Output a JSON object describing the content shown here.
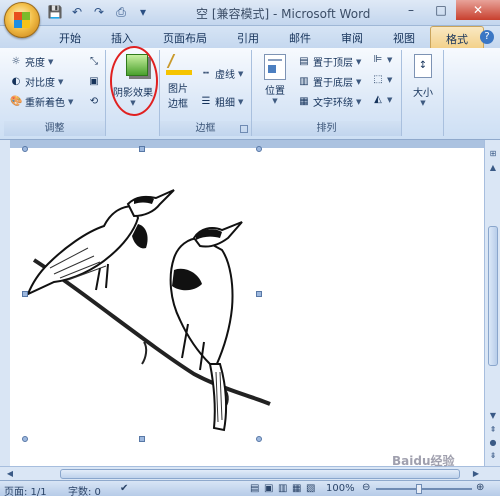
{
  "window": {
    "title": "空 [兼容模式] - Microsoft Word",
    "controls": {
      "minimize": "–",
      "maximize": "□",
      "close": "✕"
    }
  },
  "quick_access": [
    {
      "name": "save-icon",
      "glyph": "💾"
    },
    {
      "name": "undo-icon",
      "glyph": "↶"
    },
    {
      "name": "redo-icon",
      "glyph": "↷"
    },
    {
      "name": "print-icon",
      "glyph": "⎙"
    },
    {
      "name": "customize-icon",
      "glyph": "▾"
    }
  ],
  "tabs": [
    {
      "label": "开始"
    },
    {
      "label": "插入"
    },
    {
      "label": "页面布局"
    },
    {
      "label": "引用"
    },
    {
      "label": "邮件"
    },
    {
      "label": "审阅"
    },
    {
      "label": "视图"
    },
    {
      "label": "格式",
      "active": true
    }
  ],
  "ribbon": {
    "adjust": {
      "label": "调整",
      "brightness": "亮度",
      "contrast": "对比度",
      "recolor": "重新着色"
    },
    "shadow": {
      "label_line1": "阴影效果"
    },
    "border": {
      "label": "边框",
      "picture_border_line1": "图片",
      "picture_border_line2": "边框",
      "dashes": "虚线",
      "weight": "粗细"
    },
    "arrange": {
      "label": "排列",
      "position": "位置",
      "bring_front": "置于顶层",
      "send_back": "置于底层",
      "text_wrap": "文字环绕"
    },
    "size": {
      "label": "大小"
    }
  },
  "statusbar": {
    "page": "页面: 1/1",
    "words": "字数: 0",
    "zoom": "100%",
    "watermark": "Baidu经验"
  }
}
